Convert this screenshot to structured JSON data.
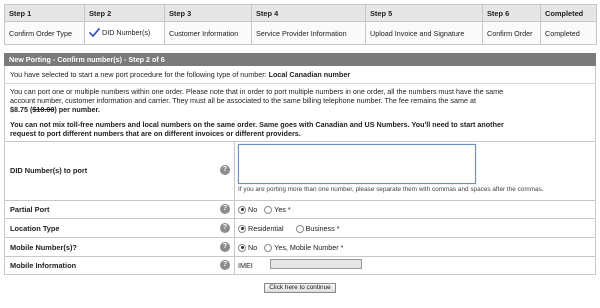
{
  "steps": {
    "headers": [
      "Step 1",
      "Step 2",
      "Step 3",
      "Step 4",
      "Step 5",
      "Step 6",
      "Completed"
    ],
    "values": [
      "Confirm Order Type",
      "DID Number(s)",
      "Customer Information",
      "Service Provider Information",
      "Upload Invoice and Signature",
      "Confirm Order",
      "Completed"
    ]
  },
  "section": {
    "title": "New Porting - Confirm number(s) - Step 2 of 6"
  },
  "info": {
    "selected_prefix": "You have selected to start a new port procedure for the following type of number: ",
    "selected_type": "Local Canadian number",
    "para1_line1": "You can port one or multiple numbers within one order. Please note that in order to port multiple numbers in one order, all the numbers must have the same",
    "para1_line2": "account number, customer information and carrier. They must all be associated to the same billing telephone number. The fee remains the same at",
    "fee_new": "$8.75 (",
    "fee_old": "$10.00",
    "fee_suffix": ") per number.",
    "warning_line1": "You can not mix toll-free numbers and local numbers on the same order. Same goes with Canadian and US Numbers. You'll need to start another",
    "warning_line2": "request to port different numbers that are on different invoices or different providers."
  },
  "form": {
    "did_label": "DID Number(s) to port",
    "did_value": "",
    "did_hint": "If you are porting more than one number, please separate them with commas and spaces after the commas.",
    "partial_label": "Partial Port",
    "partial_no": "No",
    "partial_yes": "Yes *",
    "location_label": "Location Type",
    "location_residential": "Residential",
    "location_business": "Business *",
    "mobile_label": "Mobile Number(s)?",
    "mobile_no": "No",
    "mobile_yes": "Yes, Mobile Number *",
    "mobile_info_label": "Mobile Information",
    "imei_label": "IMEI",
    "imei_value": "",
    "help_glyph": "?",
    "continue_label": "Click here to continue"
  },
  "icons": {
    "step2": "check-icon",
    "help": "question-icon"
  },
  "colors": {
    "section_header": "#7a7a7a",
    "table_header": "#e6e6e6",
    "check_icon": "#3b5cc4"
  }
}
